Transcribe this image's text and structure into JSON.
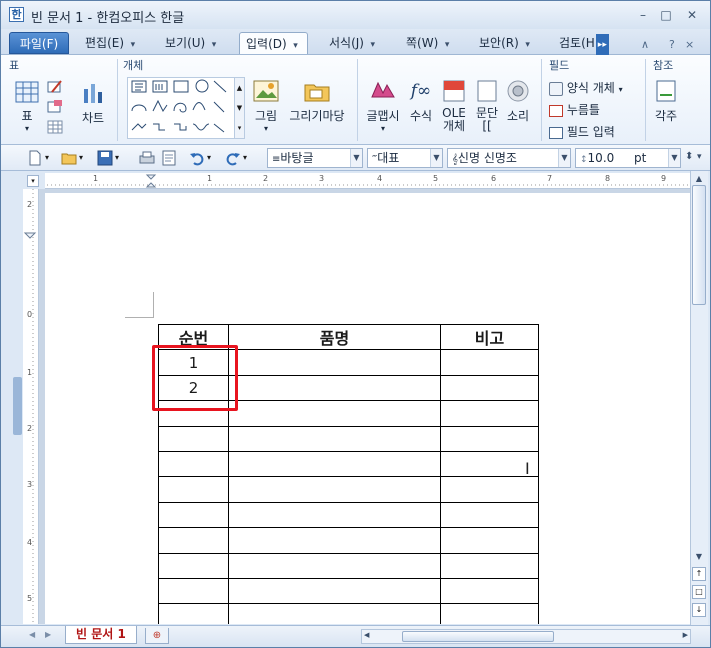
{
  "window": {
    "title": "빈 문서 1 - 한컴오피스 한글",
    "app_icon_glyph": "한"
  },
  "menu": {
    "tabs": [
      {
        "label": "파일(F)"
      },
      {
        "label": "편집(E)"
      },
      {
        "label": "보기(U)"
      },
      {
        "label": "입력(D)"
      },
      {
        "label": "서식(J)"
      },
      {
        "label": "쪽(W)"
      },
      {
        "label": "보안(R)"
      },
      {
        "label": "검토(H"
      }
    ]
  },
  "ribbon": {
    "groups": {
      "table": "표",
      "object": "개체",
      "field": "필드",
      "reference": "참조"
    },
    "buttons": {
      "table": "표",
      "chart": "차트",
      "picture": "그림",
      "drawing_mart": "그리기마당",
      "glyph_art": "글맵시",
      "equation": "수식",
      "ole": "OLE",
      "ole2": "개체",
      "paragraph": "문단",
      "paragraph2": "[[",
      "sound": "소리",
      "footnote": "각주"
    },
    "field_items": {
      "form_object": "양식 개체",
      "press_button": "누름틀",
      "field_input": "필드 입력"
    }
  },
  "toolbar": {
    "style": "바탕글",
    "language": "대표",
    "font": "신명 신명조",
    "size": "10.0",
    "unit": "pt"
  },
  "table": {
    "headers": [
      "순번",
      "품명",
      "비고"
    ],
    "rows": [
      [
        "1",
        "",
        ""
      ],
      [
        "2",
        "",
        ""
      ],
      [
        "",
        "",
        ""
      ],
      [
        "",
        "",
        ""
      ],
      [
        "",
        "",
        ""
      ],
      [
        "",
        "",
        ""
      ],
      [
        "",
        "",
        ""
      ],
      [
        "",
        "",
        ""
      ],
      [
        "",
        "",
        ""
      ],
      [
        "",
        "",
        ""
      ],
      [
        "",
        "",
        ""
      ]
    ]
  },
  "status": {
    "doc_tab": "빈 문서 1"
  },
  "colors": {
    "highlight": "#e8141f",
    "accent": "#2f6cb8"
  }
}
